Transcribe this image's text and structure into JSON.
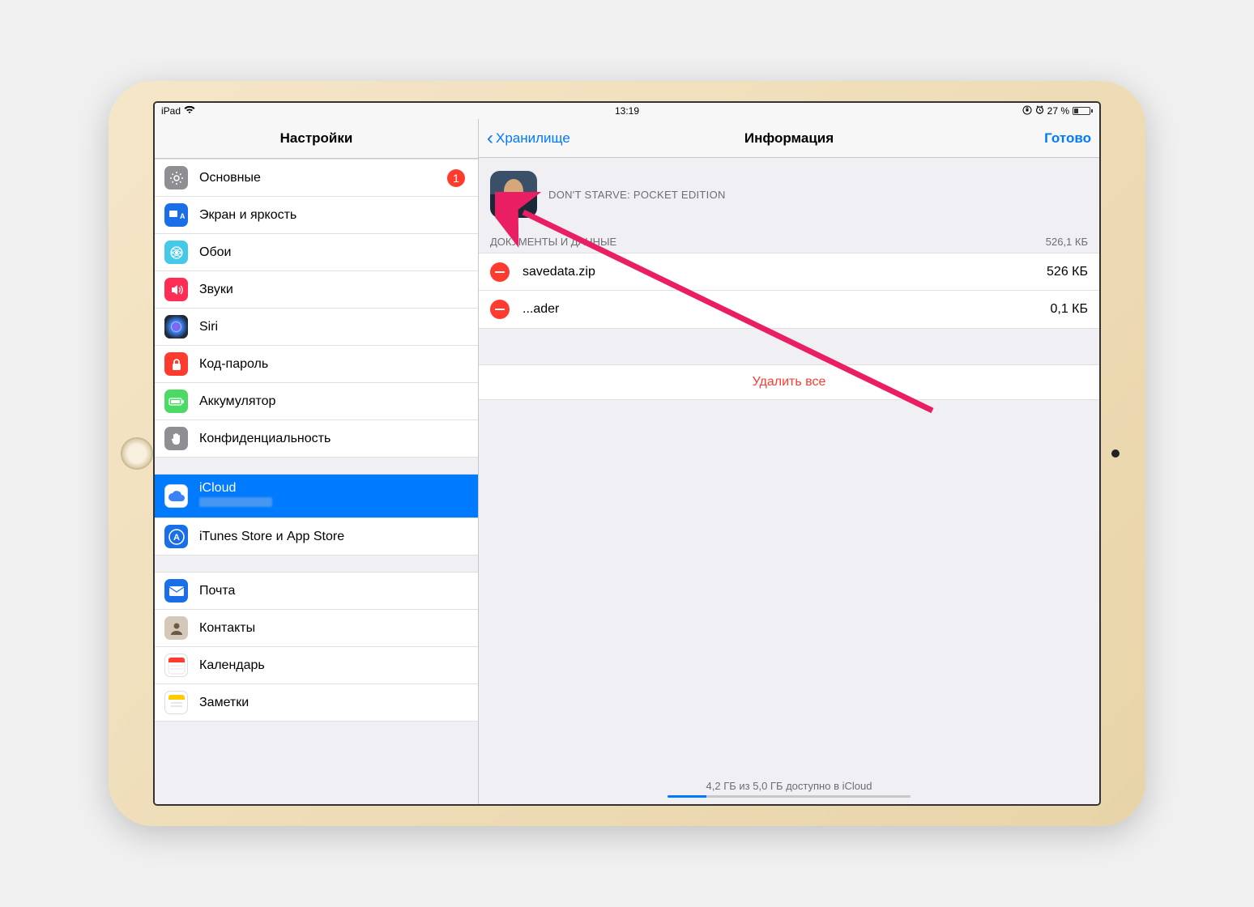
{
  "statusbar": {
    "device": "iPad",
    "time": "13:19",
    "battery_pct": "27 %"
  },
  "sidebar": {
    "title": "Настройки",
    "groups": [
      [
        {
          "label": "Основные",
          "badge": "1",
          "icon": "gear",
          "bg": "#8e8e93"
        },
        {
          "label": "Экран и яркость",
          "icon": "display",
          "bg": "#1a6fe8"
        },
        {
          "label": "Обои",
          "icon": "wallpaper",
          "bg": "#46c8e8"
        },
        {
          "label": "Звуки",
          "icon": "sound",
          "bg": "#ff2d55"
        },
        {
          "label": "Siri",
          "icon": "siri",
          "bg": "#222"
        },
        {
          "label": "Код-пароль",
          "icon": "lock",
          "bg": "#ff3b30"
        },
        {
          "label": "Аккумулятор",
          "icon": "battery",
          "bg": "#4cd964"
        },
        {
          "label": "Конфиденциальность",
          "icon": "hand",
          "bg": "#8e8e93"
        }
      ],
      [
        {
          "label": "iCloud",
          "icon": "cloud",
          "bg": "#fff",
          "selected": true,
          "sub": true
        },
        {
          "label": "iTunes Store и App Store",
          "icon": "appstore",
          "bg": "#1a6fe8"
        }
      ],
      [
        {
          "label": "Почта",
          "icon": "mail",
          "bg": "#1a6fe8"
        },
        {
          "label": "Контакты",
          "icon": "contacts",
          "bg": "#a8947a"
        },
        {
          "label": "Календарь",
          "icon": "calendar",
          "bg": "#fff"
        },
        {
          "label": "Заметки",
          "icon": "notes",
          "bg": "#ffcc00"
        }
      ]
    ]
  },
  "main": {
    "back": "Хранилище",
    "title": "Информация",
    "done": "Готово",
    "app_name": "DON'T STARVE: POCKET EDITION",
    "section_title": "ДОКУМЕНТЫ И ДАННЫЕ",
    "section_size": "526,1 КБ",
    "files": [
      {
        "name": "savedata.zip",
        "size": "526 КБ"
      },
      {
        "name": "...ader",
        "size": "0,1 КБ"
      }
    ],
    "delete_all": "Удалить все",
    "storage_text": "4,2 ГБ из 5,0 ГБ доступно в iCloud"
  }
}
